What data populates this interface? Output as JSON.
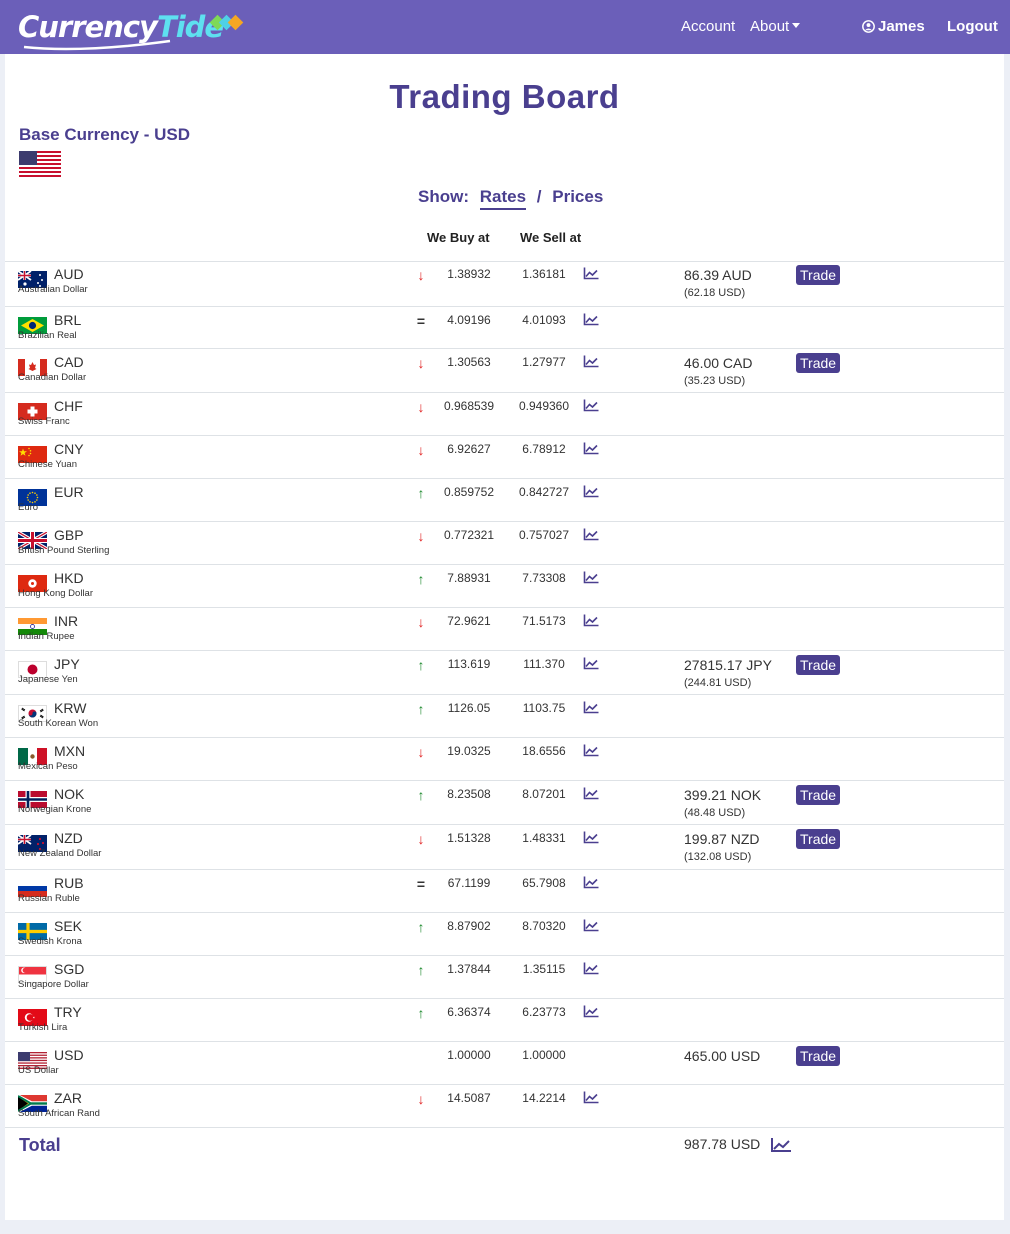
{
  "nav": {
    "brand_part1": "Currency",
    "brand_part2": "Tide",
    "account": "Account",
    "about": "About",
    "user": "James",
    "logout": "Logout"
  },
  "page": {
    "title": "Trading Board",
    "base_label": "Base Currency - USD",
    "show_label": "Show:",
    "show_rates": "Rates",
    "show_separator": "/",
    "show_prices": "Prices",
    "col_buy": "We Buy at",
    "col_sell": "We Sell at",
    "total_label": "Total",
    "total_value": "987.78 USD"
  },
  "trade_label": "Trade",
  "colors": {
    "nav_bg": "#6b5fb9",
    "accent": "#4a3f8f",
    "down": "#e02020",
    "up": "#1e8a2e"
  },
  "currencies": [
    {
      "code": "AUD",
      "name": "Australian Dollar",
      "trend": "down",
      "buy": "1.38932",
      "sell": "1.36181",
      "chart": true,
      "holding": "86.39 AUD",
      "holding_usd": "(62.18 USD)"
    },
    {
      "code": "BRL",
      "name": "Brazilian Real",
      "trend": "eq",
      "buy": "4.09196",
      "sell": "4.01093",
      "chart": true
    },
    {
      "code": "CAD",
      "name": "Canadian Dollar",
      "trend": "down",
      "buy": "1.30563",
      "sell": "1.27977",
      "chart": true,
      "holding": "46.00 CAD",
      "holding_usd": "(35.23 USD)"
    },
    {
      "code": "CHF",
      "name": "Swiss Franc",
      "trend": "down",
      "buy": "0.968539",
      "sell": "0.949360",
      "chart": true
    },
    {
      "code": "CNY",
      "name": "Chinese Yuan",
      "trend": "down",
      "buy": "6.92627",
      "sell": "6.78912",
      "chart": true
    },
    {
      "code": "EUR",
      "name": "Euro",
      "trend": "up",
      "buy": "0.859752",
      "sell": "0.842727",
      "chart": true
    },
    {
      "code": "GBP",
      "name": "British Pound Sterling",
      "trend": "down",
      "buy": "0.772321",
      "sell": "0.757027",
      "chart": true
    },
    {
      "code": "HKD",
      "name": "Hong Kong Dollar",
      "trend": "up",
      "buy": "7.88931",
      "sell": "7.73308",
      "chart": true
    },
    {
      "code": "INR",
      "name": "Indian Rupee",
      "trend": "down",
      "buy": "72.9621",
      "sell": "71.5173",
      "chart": true
    },
    {
      "code": "JPY",
      "name": "Japanese Yen",
      "trend": "up",
      "buy": "113.619",
      "sell": "111.370",
      "chart": true,
      "holding": "27815.17 JPY",
      "holding_usd": "(244.81 USD)"
    },
    {
      "code": "KRW",
      "name": "South Korean Won",
      "trend": "up",
      "buy": "1126.05",
      "sell": "1103.75",
      "chart": true
    },
    {
      "code": "MXN",
      "name": "Mexican Peso",
      "trend": "down",
      "buy": "19.0325",
      "sell": "18.6556",
      "chart": true
    },
    {
      "code": "NOK",
      "name": "Norwegian Krone",
      "trend": "up",
      "buy": "8.23508",
      "sell": "8.07201",
      "chart": true,
      "holding": "399.21 NOK",
      "holding_usd": "(48.48 USD)"
    },
    {
      "code": "NZD",
      "name": "New Zealand Dollar",
      "trend": "down",
      "buy": "1.51328",
      "sell": "1.48331",
      "chart": true,
      "holding": "199.87 NZD",
      "holding_usd": "(132.08 USD)"
    },
    {
      "code": "RUB",
      "name": "Russian Ruble",
      "trend": "eq",
      "buy": "67.1199",
      "sell": "65.7908",
      "chart": true
    },
    {
      "code": "SEK",
      "name": "Swedish Krona",
      "trend": "up",
      "buy": "8.87902",
      "sell": "8.70320",
      "chart": true
    },
    {
      "code": "SGD",
      "name": "Singapore Dollar",
      "trend": "up",
      "buy": "1.37844",
      "sell": "1.35115",
      "chart": true
    },
    {
      "code": "TRY",
      "name": "Turkish Lira",
      "trend": "up",
      "buy": "6.36374",
      "sell": "6.23773",
      "chart": true
    },
    {
      "code": "USD",
      "name": "US Dollar",
      "trend": "none",
      "buy": "1.00000",
      "sell": "1.00000",
      "chart": false,
      "holding": "465.00 USD"
    },
    {
      "code": "ZAR",
      "name": "South African Rand",
      "trend": "down",
      "buy": "14.5087",
      "sell": "14.2214",
      "chart": true
    }
  ]
}
